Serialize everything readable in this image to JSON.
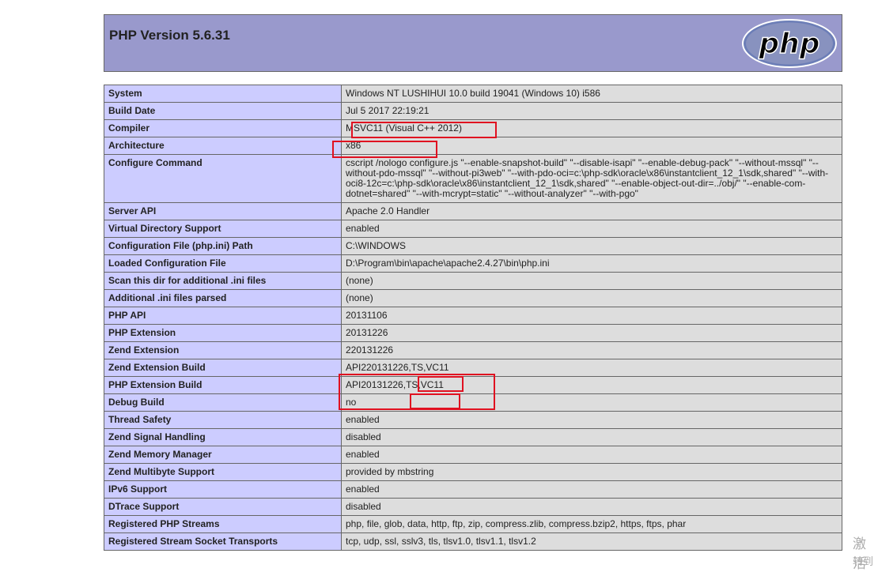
{
  "header": {
    "title": "PHP Version 5.6.31",
    "logo_text": "php"
  },
  "rows": [
    {
      "key": "System",
      "value": "Windows NT LUSHIHUI 10.0 build 19041 (Windows 10) i586"
    },
    {
      "key": "Build Date",
      "value": "Jul 5 2017 22:19:21"
    },
    {
      "key": "Compiler",
      "value": "MSVC11 (Visual C++ 2012)"
    },
    {
      "key": "Architecture",
      "value": "x86"
    },
    {
      "key": "Configure Command",
      "value": "cscript /nologo configure.js \"--enable-snapshot-build\" \"--disable-isapi\" \"--enable-debug-pack\" \"--without-mssql\" \"--without-pdo-mssql\" \"--without-pi3web\" \"--with-pdo-oci=c:\\php-sdk\\oracle\\x86\\instantclient_12_1\\sdk,shared\" \"--with-oci8-12c=c:\\php-sdk\\oracle\\x86\\instantclient_12_1\\sdk,shared\" \"--enable-object-out-dir=../obj/\" \"--enable-com-dotnet=shared\" \"--with-mcrypt=static\" \"--without-analyzer\" \"--with-pgo\""
    },
    {
      "key": "Server API",
      "value": "Apache 2.0 Handler"
    },
    {
      "key": "Virtual Directory Support",
      "value": "enabled"
    },
    {
      "key": "Configuration File (php.ini) Path",
      "value": "C:\\WINDOWS"
    },
    {
      "key": "Loaded Configuration File",
      "value": "D:\\Program\\bin\\apache\\apache2.4.27\\bin\\php.ini"
    },
    {
      "key": "Scan this dir for additional .ini files",
      "value": "(none)"
    },
    {
      "key": "Additional .ini files parsed",
      "value": "(none)"
    },
    {
      "key": "PHP API",
      "value": "20131106"
    },
    {
      "key": "PHP Extension",
      "value": "20131226"
    },
    {
      "key": "Zend Extension",
      "value": "220131226"
    },
    {
      "key": "Zend Extension Build",
      "value": "API220131226,TS,VC11"
    },
    {
      "key": "PHP Extension Build",
      "value": "API20131226,TS,VC11"
    },
    {
      "key": "Debug Build",
      "value": "no"
    },
    {
      "key": "Thread Safety",
      "value": "enabled"
    },
    {
      "key": "Zend Signal Handling",
      "value": "disabled"
    },
    {
      "key": "Zend Memory Manager",
      "value": "enabled"
    },
    {
      "key": "Zend Multibyte Support",
      "value": "provided by mbstring"
    },
    {
      "key": "IPv6 Support",
      "value": "enabled"
    },
    {
      "key": "DTrace Support",
      "value": "disabled"
    },
    {
      "key": "Registered PHP Streams",
      "value": "php, file, glob, data, http, ftp, zip, compress.zlib, compress.bzip2, https, ftps, phar"
    },
    {
      "key": "Registered Stream Socket Transports",
      "value": "tcp, udp, ssl, sslv3, tls, tlsv1.0, tlsv1.1, tlsv1.2"
    }
  ],
  "side_text": {
    "line1": "激活",
    "line2": "转到"
  },
  "colors": {
    "header_bg": "#9999cc",
    "key_bg": "#ccccff",
    "value_bg": "#dddddd",
    "highlight": "#e01020"
  }
}
